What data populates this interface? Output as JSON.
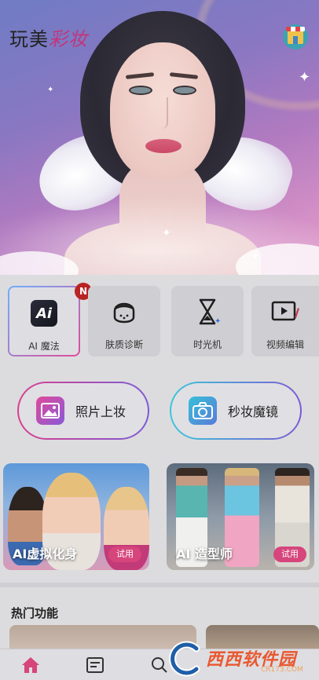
{
  "app": {
    "title_part1": "玩美",
    "title_part2": "彩妆",
    "store_icon": "store-icon"
  },
  "tools": [
    {
      "label": "AI 魔法",
      "icon": "ai-magic-icon",
      "badge": "N",
      "active": true
    },
    {
      "label": "肤质诊断",
      "icon": "skin-face-icon"
    },
    {
      "label": "时光机",
      "icon": "hourglass-icon"
    },
    {
      "label": "视频编辑",
      "icon": "video-edit-icon"
    }
  ],
  "camera_buttons": [
    {
      "label": "照片上妆",
      "icon": "photo-icon"
    },
    {
      "label": "秒妆魔镜",
      "icon": "camera-icon"
    }
  ],
  "feature_cards": [
    {
      "title": "AI虚拟化身",
      "button": "试用"
    },
    {
      "title": "AI 造型师",
      "button": "试用"
    }
  ],
  "hot_section": {
    "title": "热门功能"
  },
  "bottom_nav": [
    {
      "name": "home",
      "icon": "home-icon",
      "active": true
    },
    {
      "name": "news",
      "icon": "news-icon"
    },
    {
      "name": "search",
      "icon": "search-icon"
    }
  ],
  "watermark": {
    "text": "西西软件园",
    "sub": "CR173.COM"
  },
  "colors": {
    "accent_pink": "#d6457c",
    "home_active": "#d6457c",
    "badge": "#b82323"
  }
}
